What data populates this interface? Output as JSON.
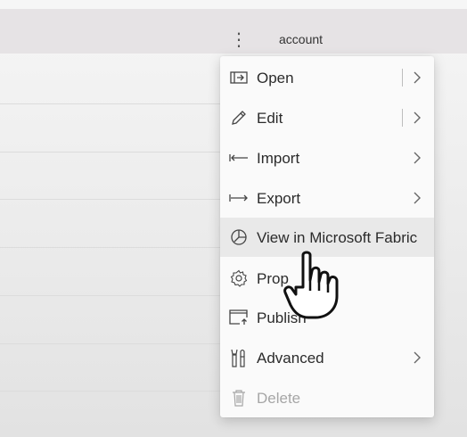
{
  "header": {
    "column_label": "account",
    "more_icon": "more-vertical-icon"
  },
  "menu": {
    "items": [
      {
        "label": "Open",
        "icon": "open-window-icon",
        "split": true,
        "submenu": true,
        "state": "normal"
      },
      {
        "label": "Edit",
        "icon": "pencil-icon",
        "split": true,
        "submenu": true,
        "state": "normal"
      },
      {
        "label": "Import",
        "icon": "import-arrow-icon",
        "split": false,
        "submenu": true,
        "state": "normal"
      },
      {
        "label": "Export",
        "icon": "export-arrow-icon",
        "split": false,
        "submenu": true,
        "state": "normal"
      },
      {
        "label": "View in Microsoft Fabric",
        "icon": "fabric-icon",
        "split": false,
        "submenu": false,
        "state": "hover"
      },
      {
        "label": "Prop",
        "icon": "gear-icon",
        "split": false,
        "submenu": false,
        "state": "normal"
      },
      {
        "label": "Publish",
        "icon": "publish-icon",
        "split": false,
        "submenu": false,
        "state": "normal"
      },
      {
        "label": "Advanced",
        "icon": "tools-icon",
        "split": false,
        "submenu": true,
        "state": "normal"
      },
      {
        "label": "Delete",
        "icon": "trash-icon",
        "split": false,
        "submenu": false,
        "state": "disabled"
      }
    ]
  },
  "cursor": {
    "type": "hand-pointer-icon"
  }
}
